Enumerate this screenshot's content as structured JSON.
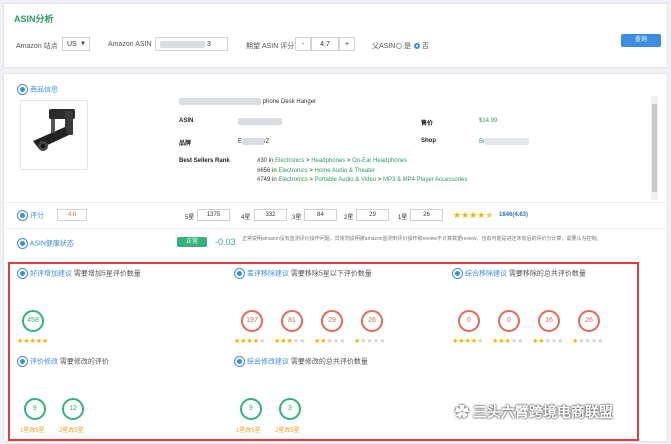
{
  "header": {
    "title": "ASIN分析",
    "amazon_site_label": "Amazon 站点",
    "amazon_site_value": "US",
    "amazon_asin_label": "Amazon ASIN",
    "asin_input_suffix": "3",
    "expected_rating_label": "期望 ASIN 评分",
    "minus": "-",
    "expected_rating_value": "4.7",
    "plus": "+",
    "is_asin_label": "父ASIN",
    "radio_yes": "是",
    "radio_no": "否",
    "query_button": "查询"
  },
  "product": {
    "section_title": "商品信息",
    "name_suffix": "phone Desk Hanger",
    "asin_label": "ASIN",
    "price_label": "售价",
    "price_value": "$14.99",
    "brand_label": "品牌",
    "brand_value_prefix": "E",
    "brand_value_suffix": "/Z",
    "shop_label": "Shop",
    "shop_value_prefix": "Br",
    "bsr_label": "Best Sellers Rank",
    "bsr": [
      {
        "rank": "#30 in",
        "path": [
          "Electronics",
          "Headphones",
          "On-Ear Headphones"
        ]
      },
      {
        "rank": "#656 in",
        "path": [
          "Electronics",
          "Home Audio & Theater"
        ]
      },
      {
        "rank": "#749 in",
        "path": [
          "Electronics",
          "Portable Audio & Video",
          "MP3 & MP4 Player Accessories"
        ]
      }
    ]
  },
  "rating": {
    "label": "评分",
    "value": "4.6",
    "star5_label": "5星",
    "star5": "1375",
    "star4_label": "4星",
    "star4": "332",
    "star3_label": "3星",
    "star3": "84",
    "star2_label": "2星",
    "star2": "29",
    "star1_label": "1星",
    "star1": "26",
    "summary": "1846(4.63)"
  },
  "health": {
    "label": "ASIN健康状态",
    "badge": "正常",
    "delta": "-0.03",
    "note": "正常说明amazon没有监测评价操作问题，异常则说明被amazon监测到评价操作和review不计算数据review，也有可能是进还未有后的评价分计算，需要认为控制。"
  },
  "suggestions": {
    "good_add": {
      "title": "好评增加建议",
      "desc": "需要增加5星评价数量",
      "circles": [
        "458"
      ]
    },
    "bad_remove": {
      "title": "差评移除建议",
      "desc": "需要移除5星以下评价数量",
      "circles": [
        "197",
        "81",
        "29",
        "26"
      ]
    },
    "combined_remove": {
      "title": "综合移除建议",
      "desc": "需要移除的总共评价数量",
      "circles": [
        "0",
        "0",
        "16",
        "26"
      ]
    },
    "review_edit": {
      "title": "评价修改",
      "desc": "需要修改的评价",
      "circles": [
        "9",
        "12"
      ],
      "subs": [
        "1星改5星",
        "2星改5星"
      ]
    },
    "combined_edit": {
      "title": "综合修改建议",
      "desc": "需要修改的总共评价数量",
      "circles": [
        "9",
        "3"
      ],
      "subs": [
        "1星改5星",
        "2星改5星"
      ]
    }
  },
  "watermark": "三头六臂跨境电商联盟",
  "colors": {
    "accent_green": "#2f9b61",
    "accent_blue": "#3d8ee0",
    "bad_red": "#e06b5a",
    "good_green": "#34b27b",
    "star": "#f0b400",
    "frame_red": "#e23b3b"
  }
}
